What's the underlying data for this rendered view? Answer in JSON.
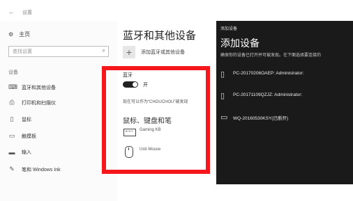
{
  "window": {
    "back_glyph": "←",
    "title": "设置"
  },
  "sidebar": {
    "home_label": "主页",
    "search_placeholder": "查找设置",
    "section_label": "设备",
    "items": [
      {
        "label": "蓝牙和其他设备",
        "icon": "bluetooth-devices-icon"
      },
      {
        "label": "打印机和扫描仪",
        "icon": "printer-icon"
      },
      {
        "label": "鼠标",
        "icon": "mouse-icon"
      },
      {
        "label": "触摸板",
        "icon": "touchpad-icon"
      },
      {
        "label": "输入",
        "icon": "keyboard-icon"
      },
      {
        "label": "笔和 Windows Ink",
        "icon": "pen-icon"
      }
    ]
  },
  "main": {
    "title": "蓝牙和其他设备",
    "add_device_label": "添加蓝牙或其他设备",
    "bluetooth_label": "蓝牙",
    "toggle_state": "开",
    "discover_text": "现在可以作为“CHOUCHOU”被发现",
    "section_title": "鼠标、键盘和笔",
    "devices": [
      {
        "name": "Gaming KB",
        "icon": "keyboard-icon"
      },
      {
        "name": "Usb Mouse",
        "icon": "mouse-icon"
      }
    ]
  },
  "add_device_panel": {
    "small_title": "添加设备",
    "title": "添加设备",
    "description": "确保你的设备已打开并可被发现。在下面选择要连接的",
    "devices": [
      {
        "name": "PC-20170206OAEP: Administrator:",
        "icon": "computer-tower-icon"
      },
      {
        "name": "PC-20171109QZJZ: Administrator:",
        "icon": "computer-tower-icon"
      },
      {
        "name": "WQ-20160530KSY(已断开)",
        "icon": "monitor-icon"
      }
    ]
  },
  "colors": {
    "highlight_border": "#f5171b",
    "panel_bg": "#1a1a1a"
  }
}
